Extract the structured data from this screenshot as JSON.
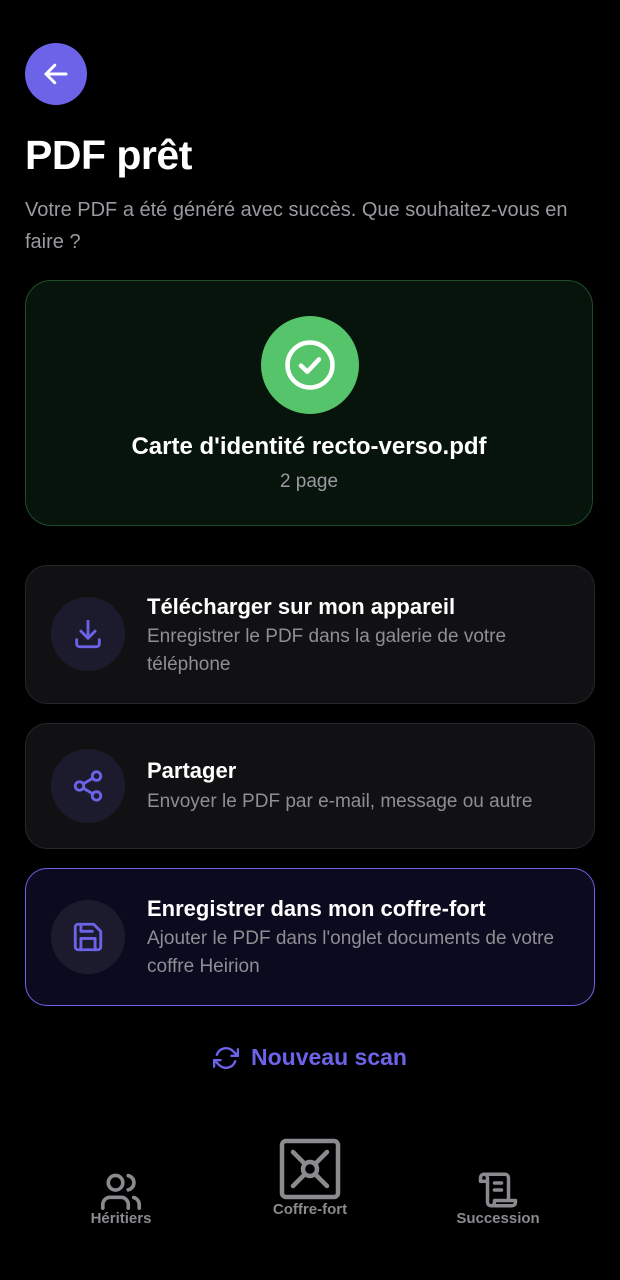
{
  "header": {
    "back_icon": "arrow-left-icon",
    "title": "PDF prêt",
    "subtitle": "Votre PDF a été généré avec succès. Que souhaitez-vous en faire ?"
  },
  "file": {
    "status_icon": "check-circle-icon",
    "name": "Carte d'identité recto-verso.pdf",
    "pages": "2 page"
  },
  "actions": [
    {
      "icon": "download-icon",
      "title": "Télécharger sur mon appareil",
      "description": "Enregistrer le PDF dans la galerie de votre téléphone"
    },
    {
      "icon": "share-icon",
      "title": "Partager",
      "description": "Envoyer le PDF par e-mail, message ou autre"
    },
    {
      "icon": "save-icon",
      "title": "Enregistrer dans mon coffre-fort",
      "description": "Ajouter le PDF dans l'onglet documents de votre coffre Heirion"
    }
  ],
  "new_scan": {
    "icon": "refresh-icon",
    "label": "Nouveau scan"
  },
  "tab_bar": {
    "items": [
      {
        "icon": "users-icon",
        "label": "Héritiers"
      },
      {
        "icon": "vault-icon",
        "label": "Coffre-fort"
      },
      {
        "icon": "scroll-icon",
        "label": "Succession"
      }
    ]
  },
  "colors": {
    "accent": "#6C63E8",
    "success": "#56C46A",
    "background": "#000000",
    "card": "#111114",
    "muted_text": "#9a9aa0",
    "tab_inactive": "#8a8a8f"
  }
}
